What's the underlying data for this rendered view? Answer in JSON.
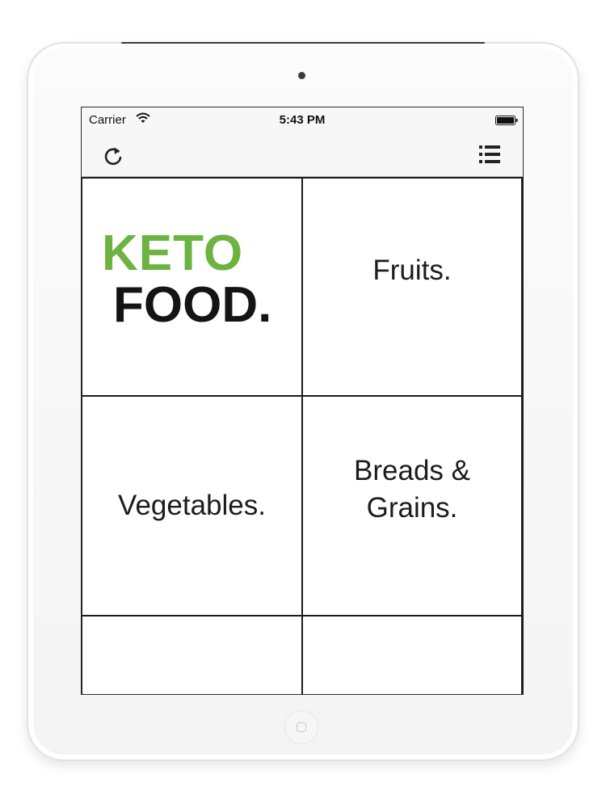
{
  "status_bar": {
    "carrier": "Carrier",
    "time": "5:43 PM"
  },
  "nav_bar": {
    "left_icon": "refresh-icon",
    "right_icon": "list-menu-icon"
  },
  "logo": {
    "line1": "KETO",
    "line2": "FOOD.",
    "line1_color": "#6cb33f",
    "line2_color": "#141414"
  },
  "categories": [
    {
      "label": "Fruits."
    },
    {
      "label": "Vegetables."
    },
    {
      "label_line1": "Breads &",
      "label_line2": "Grains."
    }
  ]
}
